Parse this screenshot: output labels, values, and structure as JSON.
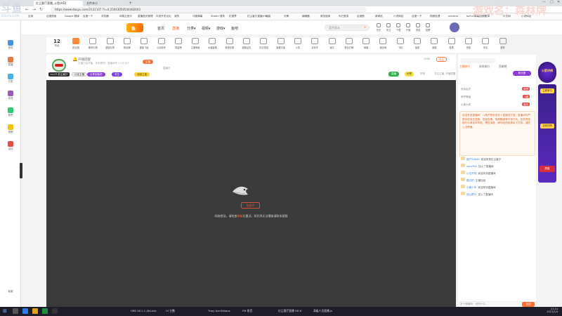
{
  "browser": {
    "tabs": [
      {
        "label": "红尘客厅直播_斗鱼(HD)",
        "active": true
      },
      {
        "label": "文件夹小",
        "active": false
      }
    ],
    "url": "https://www.douyu.com/2131147  ?r=0.25043050504482603",
    "bookmarks": [
      "应用",
      "百度搜索",
      "Google 翻译",
      "百度一下",
      "浏览器",
      "网易云音乐",
      "直播首页管理",
      "抖音开发论坛",
      "我的",
      "马路弹幕",
      "Steam 搜狗",
      "红楼梦",
      "红尘客厅直播(HD)",
      "流量",
      "无聊",
      "编辑器",
      "原创独家",
      "你已登录",
      "百度图",
      "新网站",
      "小说网站",
      "百度一下",
      "视频处理",
      "mkdirss",
      "AcFun弹幕视频网",
      "文章",
      "中文网",
      "小说网站"
    ]
  },
  "watermark": {
    "game_label": "游戏名：森林牌",
    "logo_text": "斗鱼",
    "logo_sub": "DOUYU.COM"
  },
  "sidebar": {
    "items": [
      {
        "label": "首页"
      },
      {
        "label": "直播"
      },
      {
        "label": "分类"
      },
      {
        "label": "游戏"
      },
      {
        "label": "鱼吧"
      },
      {
        "label": "视频"
      },
      {
        "label": "活动"
      }
    ],
    "bottom_label": "客服"
  },
  "nav": {
    "links": [
      {
        "label": "首页",
        "active": false
      },
      {
        "label": "直播",
        "active": true
      },
      {
        "label": "分类▾",
        "active": false
      },
      {
        "label": "视频▾",
        "active": false
      },
      {
        "label": "游戏▾",
        "active": false
      },
      {
        "label": "鱼吧",
        "active": false
      }
    ],
    "search_placeholder": "蓝色版本",
    "right_icons": [
      "历史",
      "关注",
      "下载",
      "开播",
      "消息",
      "投票"
    ]
  },
  "gift_row": {
    "level_num": "12",
    "level_label": "等级",
    "items": [
      "粉丝团",
      "稀有礼物",
      "超值礼物",
      "粉丝牌",
      "超能飞船",
      "心动信号",
      "周星榜",
      "主播等级",
      "水晶宝箱",
      "奇迹彩蛋",
      "超能钻石",
      "天空花园",
      "宝藏寻宝",
      "火箭",
      "嘉年华",
      "宝石",
      "粉丝灯牌",
      "弹幕",
      "魔法棒",
      "飞机",
      "抽奖",
      "宝箱",
      "投票",
      "贵族",
      "车队",
      "更多"
    ]
  },
  "room": {
    "title": "开播提醒",
    "subtitle": "主播已经开播，快来看吧！直播间号 2131147",
    "badges": [
      "认证主播",
      "分享到鱼吧",
      "关注",
      "收藏主播"
    ],
    "badge_alt": "直播中",
    "host_level": "Lv.27",
    "host_name": "红尘客厅",
    "follow_count": "2096",
    "share_label": "分享",
    "report_label": "举报",
    "follow_label": "关注",
    "follow_hint": "关注主播, 开播提醒",
    "live_label": "直播",
    "room_tag": "主播"
  },
  "video": {
    "loading_text": "加载中",
    "tip_prefix": "网络错误，请检查",
    "tip_link": "刷新",
    "tip_suffix": "后重试，如仍然无法播放请联系客服"
  },
  "right_panel": {
    "tabs": [
      "主播排行",
      "本场排行",
      "贡献榜",
      "粉丝团"
    ],
    "rank_items": [
      {
        "name": "贵族会员",
        "badge": "荣誉"
      },
      {
        "name": "荣誉等级",
        "badge": "1级"
      },
      {
        "name": "火箭大佬",
        "badge": "高手"
      }
    ],
    "notice": "欢迎来到直播间！斗鱼严禁未成年人直播或打赏。直播间内严禁出现违法违规、低俗色情、吸烟酗酒等不良行为。若发现违规行为请及时举报。理性消费，请勿轻信各类私下交易，谨防上当受骗。",
    "chat": [
      {
        "user": "用户26840",
        "text": "欢迎来到红尘客厅"
      },
      {
        "user": "sunyfish",
        "text": "加入了直播间"
      },
      {
        "user": "小白开导",
        "text": "欢迎来到直播间"
      },
      {
        "user": "路过的",
        "text": "主播加油"
      },
      {
        "user": "火箭少年",
        "text": "欢迎来到直播间"
      },
      {
        "user": "热心群众",
        "text": "进入了直播间"
      }
    ],
    "input_placeholder": "发个弹幕吧，说些什么...",
    "send_label": "发送"
  },
  "right_banner": {
    "title": "火箭冲榜",
    "btn1": "立即参与",
    "btn2": "活动详情",
    "tag": "周星"
  },
  "taskbar": {
    "items": [
      "OBS 26.1.1 (64-bit)",
      "UI 主播",
      "They Are Billions",
      "FM 收音",
      "红尘客厅直播 HD 8",
      "高级人员直播.js"
    ],
    "clock_time": "21:14",
    "clock_date": "2021/2/4"
  }
}
